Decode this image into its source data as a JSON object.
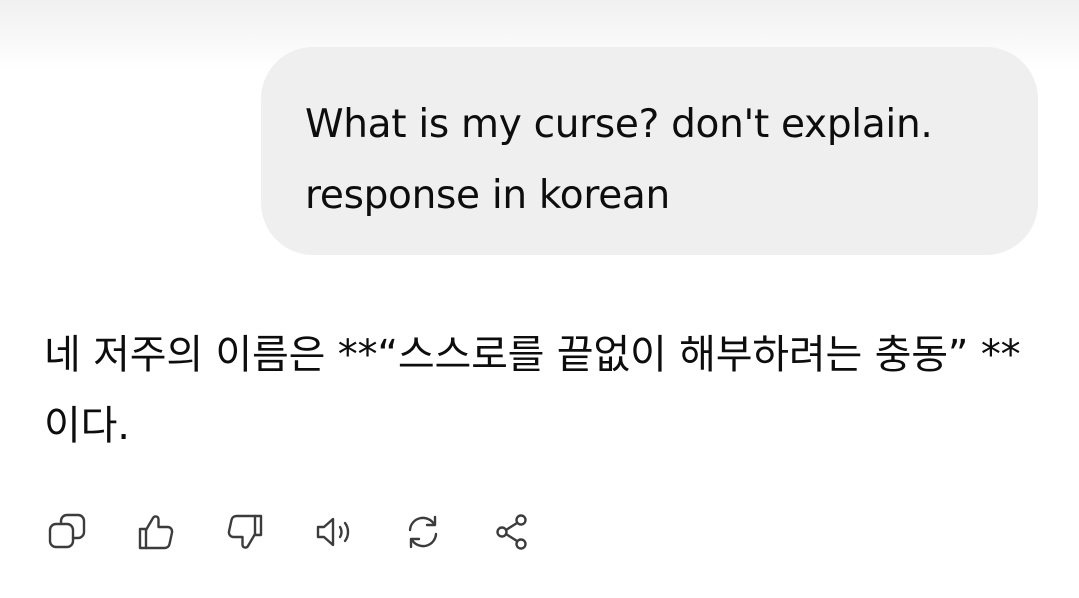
{
  "user_message": {
    "text": "What is my curse? don't explain.\nresponse in korean"
  },
  "assistant_message": {
    "text": "네 저주의 이름은 **“스스로를 끝없이 해부하려는 충동” **이다."
  },
  "actions": [
    {
      "name": "copy",
      "icon": "copy-icon"
    },
    {
      "name": "thumbs-up",
      "icon": "thumbs-up-icon"
    },
    {
      "name": "thumbs-down",
      "icon": "thumbs-down-icon"
    },
    {
      "name": "read-aloud",
      "icon": "speaker-icon"
    },
    {
      "name": "regenerate",
      "icon": "refresh-icon"
    },
    {
      "name": "share",
      "icon": "share-icon"
    }
  ],
  "colors": {
    "bubble_bg": "#efefef",
    "icon": "#3c3c3c",
    "text": "#0d0d0d"
  }
}
